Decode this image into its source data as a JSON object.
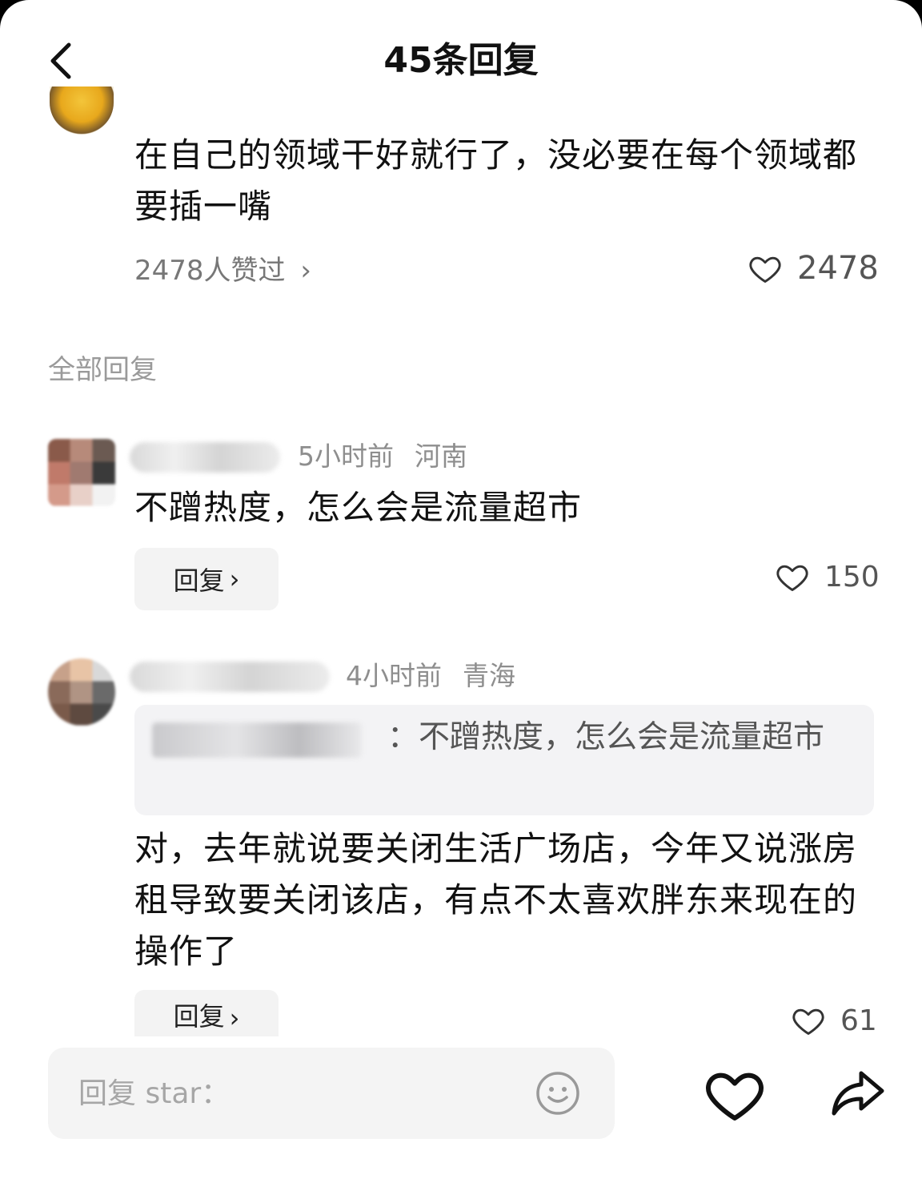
{
  "header": {
    "title": "45条回复"
  },
  "main_comment": {
    "text": "在自己的领域干好就行了，没必要在每个领域都要插一嘴",
    "likers_text": "2478人赞过",
    "likers_chevron": "›",
    "like_count": "2478"
  },
  "section": {
    "title": "全部回复"
  },
  "replies": [
    {
      "time": "5小时前",
      "location": "河南",
      "text": "不蹭热度，怎么会是流量超市",
      "reply_label": "回复",
      "reply_chevron": "›",
      "like_count": "150"
    },
    {
      "time": "4小时前",
      "location": "青海",
      "quote_text": "：不蹭热度，怎么会是流量超市",
      "text": "对，去年就说要关闭生活广场店，今年又说涨房租导致要关闭该店，有点不太喜欢胖东来现在的操作了",
      "reply_label": "回复",
      "reply_chevron": "›",
      "like_count": "61"
    }
  ],
  "input_bar": {
    "placeholder": "回复 star："
  },
  "icons": {
    "back": "back-arrow-icon",
    "heart": "heart-icon",
    "emoji": "smiley-icon",
    "share": "share-arrow-icon"
  },
  "colors": {
    "text_primary": "#111111",
    "text_secondary": "#8e8e8e",
    "button_bg": "#f3f3f3",
    "quote_bg": "#f3f3f5"
  }
}
